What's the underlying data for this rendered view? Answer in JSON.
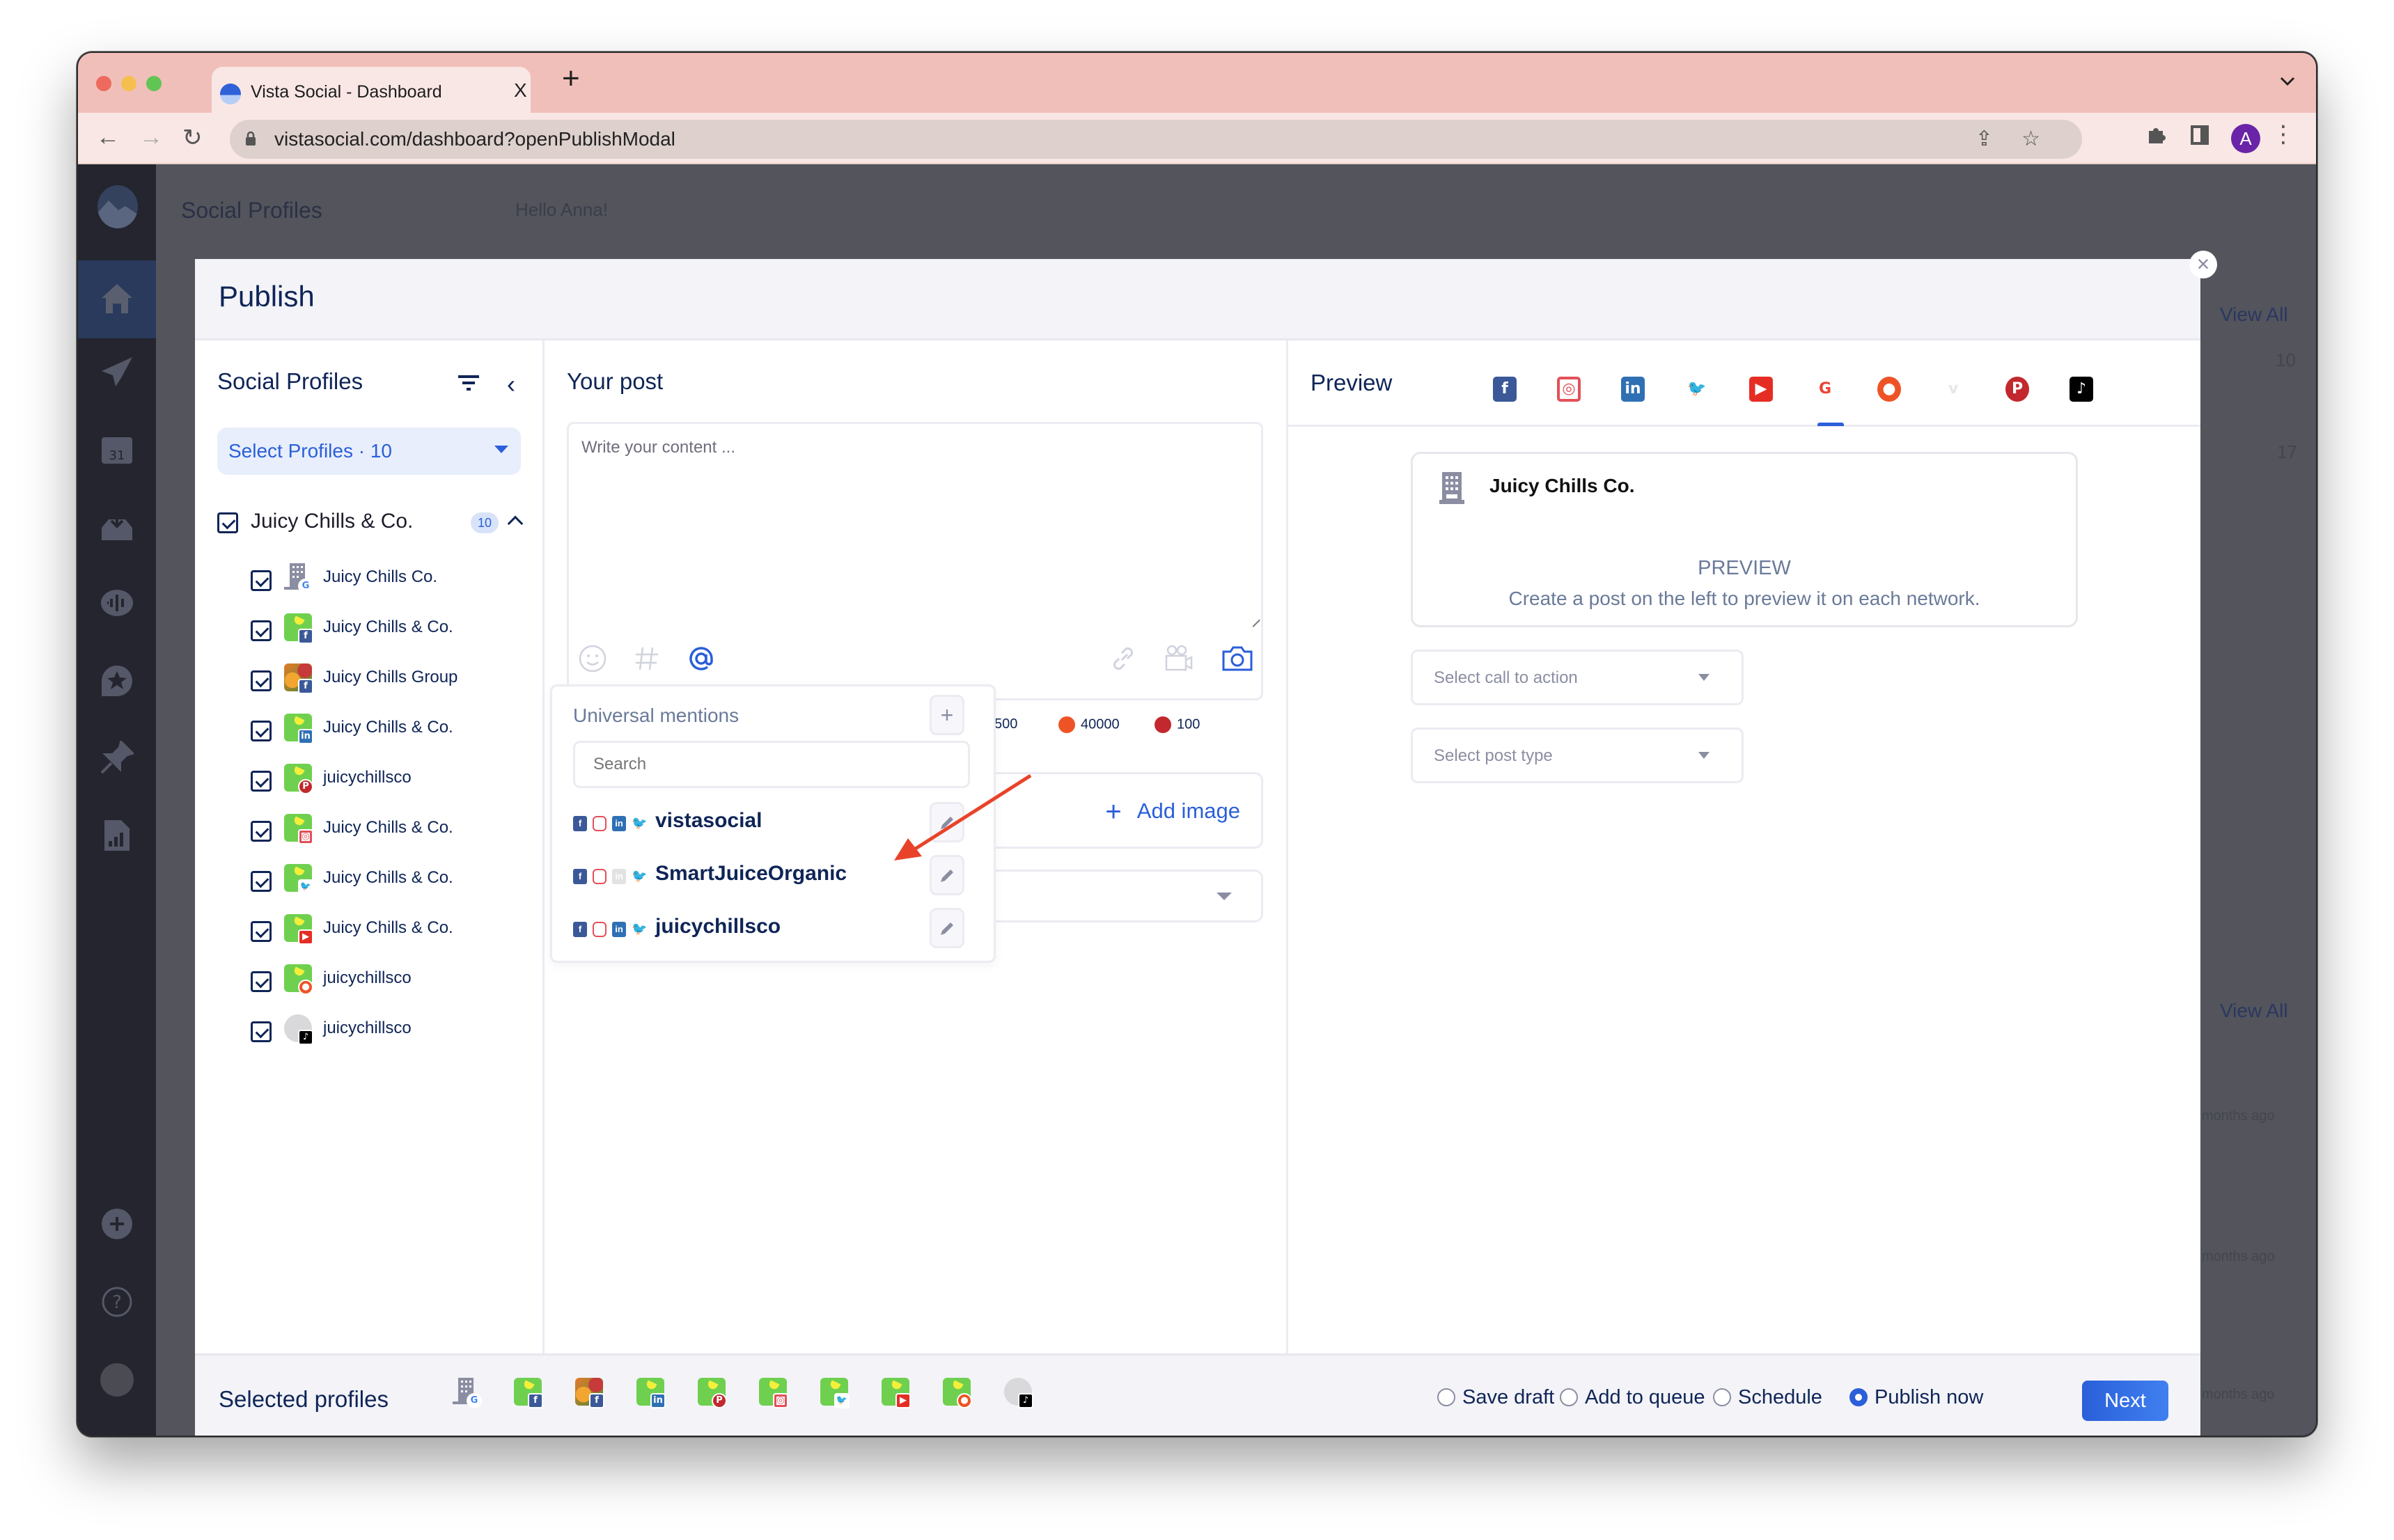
{
  "browser": {
    "tab_title": "Vista Social - Dashboard",
    "tab_close": "X",
    "new_tab": "+",
    "url": "vistasocial.com/dashboard?openPublishModal",
    "profile_initial": "A",
    "tab_menu": "⌄"
  },
  "background": {
    "page_heading": "Social Profiles",
    "greeting": "Hello Anna!",
    "view_all_1": "View All",
    "view_all_2": "View All",
    "calendar_day_1": "10",
    "calendar_day_2": "17",
    "activity_times": [
      "months ago",
      "months ago",
      "months ago"
    ],
    "sidebar_icons": [
      "home-icon",
      "paper-plane-icon",
      "calendar-icon",
      "inbox-icon",
      "listening-icon",
      "reviews-icon",
      "pin-icon",
      "report-icon",
      "add-icon",
      "help-icon",
      "user-avatar"
    ],
    "calendar_icon_text": "31"
  },
  "modal": {
    "title": "Publish",
    "close_label": "×",
    "social_profiles": {
      "title": "Social Profiles",
      "select_label": "Select Profiles · 10",
      "group": {
        "name": "Juicy Chills & Co.",
        "count": "10",
        "checked": true
      },
      "profiles": [
        {
          "name": "Juicy Chills Co.",
          "network": "google",
          "avatar": "building",
          "checked": true
        },
        {
          "name": "Juicy Chills & Co.",
          "network": "facebook",
          "avatar": "juicy-chills-logo",
          "checked": true
        },
        {
          "name": "Juicy Chills Group",
          "network": "facebook",
          "avatar": "fruit-photo",
          "checked": true
        },
        {
          "name": "Juicy Chills & Co.",
          "network": "linkedin",
          "avatar": "juicy-chills-logo",
          "checked": true
        },
        {
          "name": "juicychillsco",
          "network": "pinterest",
          "avatar": "juicy-chills-logo",
          "checked": true
        },
        {
          "name": "Juicy Chills & Co.",
          "network": "instagram",
          "avatar": "juicy-chills-logo",
          "checked": true
        },
        {
          "name": "Juicy Chills & Co.",
          "network": "twitter",
          "avatar": "juicy-chills-logo",
          "checked": true
        },
        {
          "name": "Juicy Chills & Co.",
          "network": "youtube",
          "avatar": "juicy-chills-logo",
          "checked": true
        },
        {
          "name": "juicychillsco",
          "network": "reddit",
          "avatar": "juicy-chills-logo",
          "checked": true
        },
        {
          "name": "juicychillsco",
          "network": "tiktok",
          "avatar": "default-user",
          "checked": true
        }
      ]
    },
    "your_post": {
      "title": "Your post",
      "placeholder": "Write your content ...",
      "tools_left": [
        "emoji-icon",
        "hashtag-icon",
        "mention-icon"
      ],
      "tools_right": [
        "link-icon",
        "video-icon",
        "camera-icon"
      ],
      "char_counts": [
        {
          "network": "partial",
          "value": "500"
        },
        {
          "network": "reddit",
          "value": "40000"
        },
        {
          "network": "pinterest",
          "value": "100"
        }
      ],
      "add_image_label": "Add image",
      "mentions": {
        "title": "Universal mentions",
        "add_label": "+",
        "search_placeholder": "Search",
        "items": [
          {
            "name": "vistasocial",
            "networks": {
              "facebook": true,
              "instagram": true,
              "linkedin": true,
              "twitter": true
            }
          },
          {
            "name": "SmartJuiceOrganic",
            "networks": {
              "facebook": true,
              "instagram": true,
              "linkedin": false,
              "twitter": false
            }
          },
          {
            "name": "juicychillsco",
            "networks": {
              "facebook": true,
              "instagram": true,
              "linkedin": true,
              "twitter": false
            }
          }
        ]
      }
    },
    "preview": {
      "title": "Preview",
      "tabs": [
        "facebook",
        "instagram",
        "linkedin",
        "twitter",
        "youtube",
        "google",
        "reddit",
        "vimeo",
        "pinterest",
        "tiktok"
      ],
      "active_tab": "google",
      "page_name": "Juicy Chills Co.",
      "heading": "PREVIEW",
      "subtext": "Create a post on the left to preview it on each network.",
      "cta_placeholder": "Select call to action",
      "post_type_placeholder": "Select post type"
    },
    "footer": {
      "selected_title": "Selected profiles",
      "selected_networks": [
        "google",
        "facebook",
        "facebook",
        "linkedin",
        "pinterest",
        "instagram",
        "twitter",
        "youtube",
        "reddit",
        "tiktok"
      ],
      "options": [
        {
          "label": "Save draft",
          "selected": false
        },
        {
          "label": "Add to queue",
          "selected": false
        },
        {
          "label": "Schedule",
          "selected": false
        },
        {
          "label": "Publish now",
          "selected": true
        }
      ],
      "next_label": "Next"
    }
  },
  "colors": {
    "accent": "#2a5fd9",
    "navy": "#0f2557",
    "annotation_arrow": "#e8432a"
  }
}
